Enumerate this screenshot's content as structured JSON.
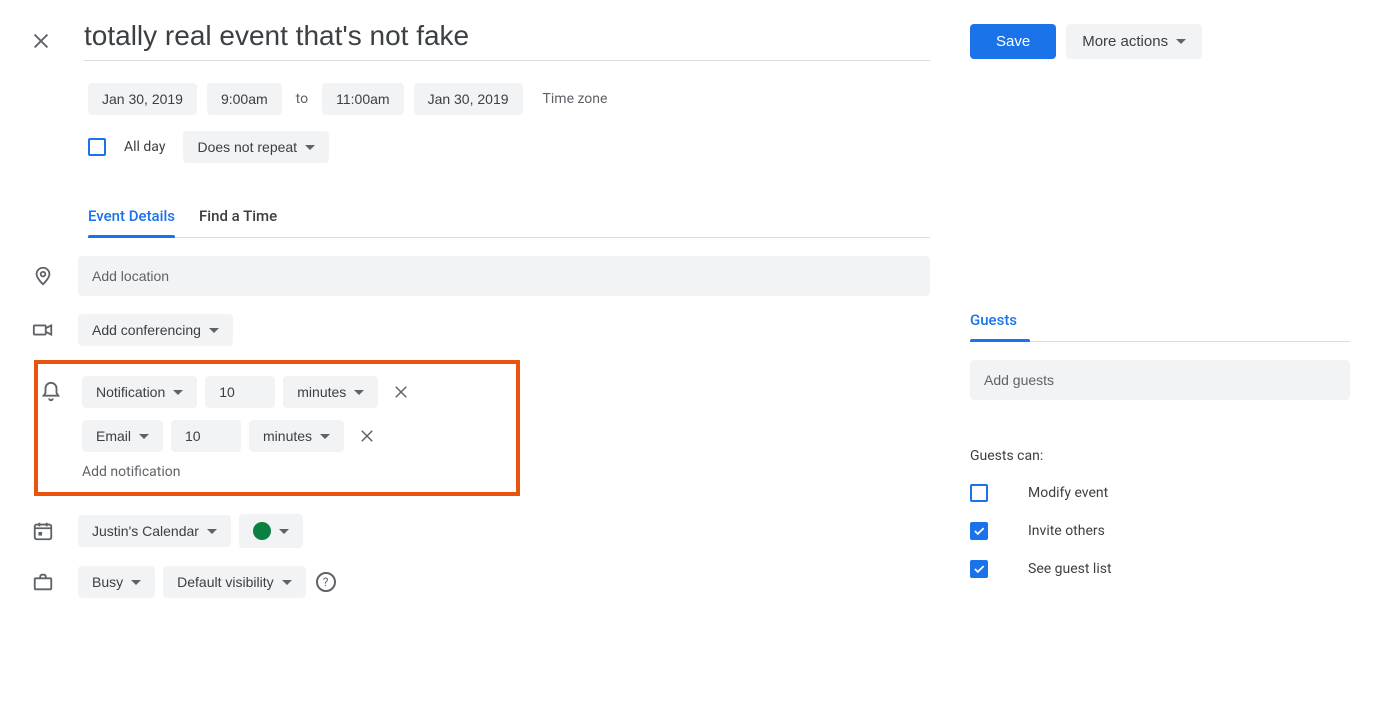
{
  "header": {
    "title_value": "totally real event that's not fake",
    "save_label": "Save",
    "more_actions_label": "More actions"
  },
  "datetime": {
    "start_date": "Jan 30, 2019",
    "start_time": "9:00am",
    "to_label": "to",
    "end_time": "11:00am",
    "end_date": "Jan 30, 2019",
    "timezone_label": "Time zone"
  },
  "allday": {
    "label": "All day",
    "repeat_label": "Does not repeat"
  },
  "tabs": {
    "event_details": "Event Details",
    "find_time": "Find a Time"
  },
  "location": {
    "placeholder": "Add location"
  },
  "conferencing": {
    "label": "Add conferencing"
  },
  "notifications": {
    "row1_type": "Notification",
    "row1_value": "10",
    "row1_unit": "minutes",
    "row2_type": "Email",
    "row2_value": "10",
    "row2_unit": "minutes",
    "add_label": "Add notification"
  },
  "calendar": {
    "name": "Justin's Calendar"
  },
  "visibility": {
    "busy_label": "Busy",
    "default_label": "Default visibility"
  },
  "guests": {
    "header": "Guests",
    "placeholder": "Add guests",
    "can_label": "Guests can:",
    "modify": "Modify event",
    "invite": "Invite others",
    "see_list": "See guest list"
  }
}
